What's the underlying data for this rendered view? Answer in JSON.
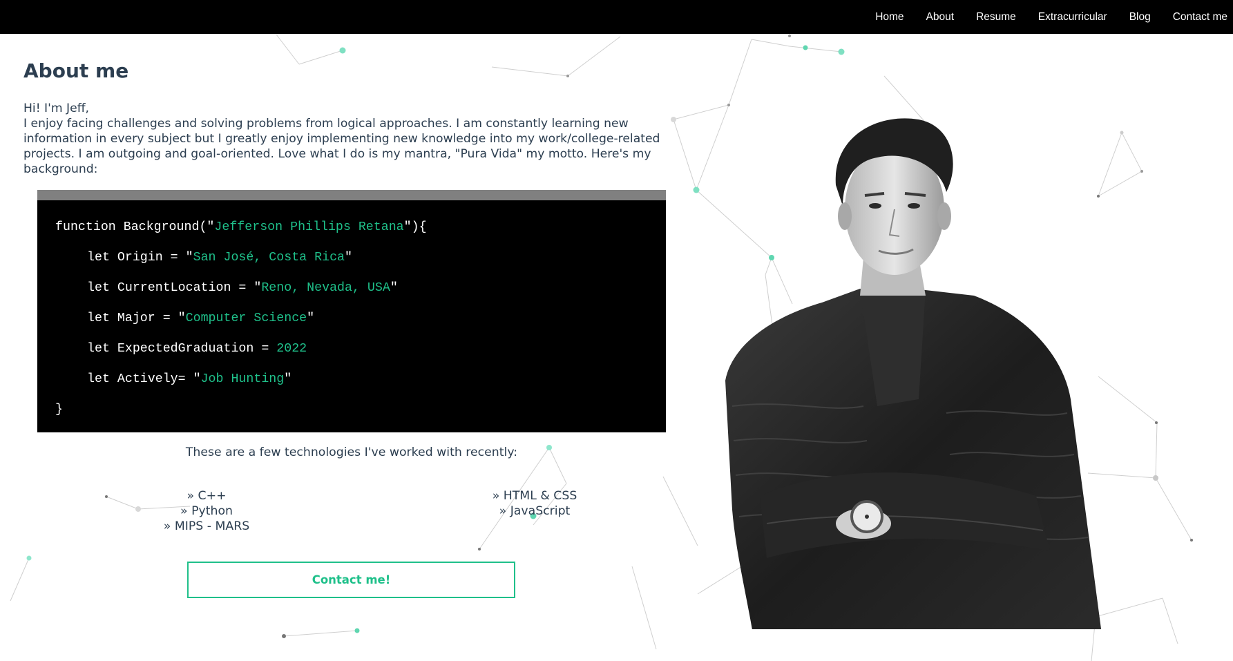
{
  "nav": {
    "items": [
      "Home",
      "About",
      "Resume",
      "Extracurricular",
      "Blog",
      "Contact me"
    ]
  },
  "about": {
    "heading": "About me",
    "greeting": "Hi! I'm Jeff,",
    "description": "I enjoy facing challenges and solving problems from logical approaches. I am constantly learning new information in every subject but I greatly enjoy implementing new knowledge into my work/college-related projects. I am outgoing and goal-oriented. Love what I do is my mantra, \"Pura Vida\" my motto. Here's my background:"
  },
  "code": {
    "function_prefix": "function Background(\"",
    "name": "Jefferson Phillips Retana",
    "function_suffix": "\"){",
    "lines": [
      {
        "prefix": "let Origin = \"",
        "value": "San José, Costa Rica",
        "suffix": "\""
      },
      {
        "prefix": "let CurrentLocation = \"",
        "value": "Reno, Nevada, USA",
        "suffix": "\""
      },
      {
        "prefix": "let Major = \"",
        "value": "Computer Science",
        "suffix": "\""
      },
      {
        "prefix": "let ExpectedGraduation = ",
        "value": "2022",
        "suffix": ""
      },
      {
        "prefix": "let Actively= \"",
        "value": "Job Hunting",
        "suffix": "\""
      }
    ],
    "closing": "}"
  },
  "technologies": {
    "intro": "These are a few technologies I've worked with recently:",
    "left": [
      "» C++",
      "» Python",
      "» MIPS - MARS"
    ],
    "right": [
      "» HTML & CSS",
      "» JavaScript"
    ]
  },
  "contact_button": {
    "label": "Contact me!"
  },
  "colors": {
    "accent": "#1fc08a",
    "navbar_bg": "#000000",
    "text": "#2c3e50",
    "code_bg": "#000000",
    "code_bar": "#808080"
  }
}
